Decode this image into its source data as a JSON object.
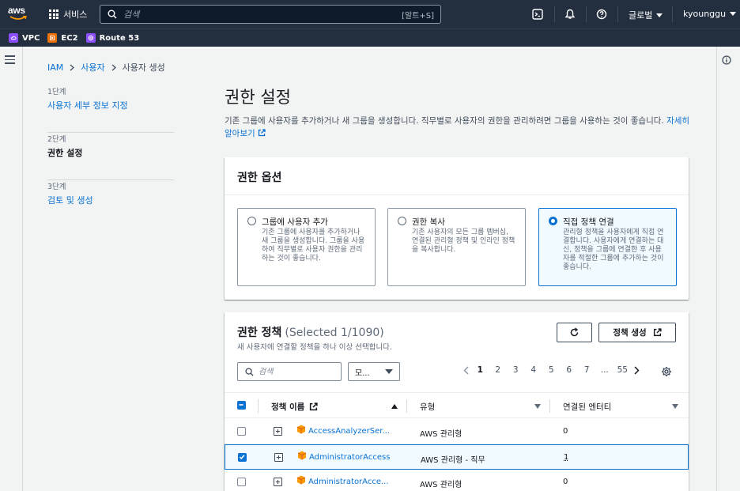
{
  "topnav": {
    "logo": "aws",
    "services_label": "서비스",
    "search_placeholder": "검색",
    "search_shortcut": "[알트+S]",
    "region_label": "글로벌",
    "user_label": "kyounggu"
  },
  "favorites": [
    {
      "label": "VPC",
      "color": "#8c4fff"
    },
    {
      "label": "EC2",
      "color": "#ed7100"
    },
    {
      "label": "Route 53",
      "color": "#8c4fff"
    }
  ],
  "breadcrumb": {
    "items": [
      "IAM",
      "사용자",
      "사용자 생성"
    ]
  },
  "steps": [
    {
      "num": "1단계",
      "title": "사용자 세부 정보 지정"
    },
    {
      "num": "2단계",
      "title": "권한 설정"
    },
    {
      "num": "3단계",
      "title": "검토 및 생성"
    }
  ],
  "page": {
    "title": "권한 설정",
    "desc": "기존 그룹에 사용자를 추가하거나 새 그룹을 생성합니다. 직무별로 사용자의 권한을 관리하려면 그룹을 사용하는 것이 좋습니다.",
    "learn_more": "자세히 알아보기"
  },
  "options": {
    "header": "권한 옵션",
    "tiles": [
      {
        "title": "그룹에 사용자 추가",
        "desc": "기존 그룹에 사용자를 추가하거나 새 그룹을 생성합니다. 그룹을 사용하여 직무별로 사용자 권한을 관리하는 것이 좋습니다."
      },
      {
        "title": "권한 복사",
        "desc": "기존 사용자의 모든 그룹 멤버십, 연결된 관리형 정책 및 인라인 정책을 복사합니다."
      },
      {
        "title": "직접 정책 연결",
        "desc": "관리형 정책을 사용자에게 직접 연결합니다. 사용자에게 연결하는 대신, 정책을 그룹에 연결한 후 사용자를 적절한 그룹에 추가하는 것이 좋습니다."
      }
    ],
    "selected_index": 2
  },
  "policies": {
    "title": "권한 정책",
    "count": "(Selected 1/1090)",
    "subtitle": "새 사용자에 연결할 정책을 하나 이상 선택합니다.",
    "create_label": "정책 생성",
    "filter_placeholder": "검색",
    "select_value": "모...",
    "pages": [
      "1",
      "2",
      "3",
      "4",
      "5",
      "6",
      "7",
      "...",
      "55"
    ],
    "current_page": "1",
    "columns": [
      "정책 이름",
      "유형",
      "연결된 엔터티"
    ],
    "rows": [
      {
        "name": "AccessAnalyzerSer...",
        "type": "AWS 관리형",
        "entities": "0",
        "checked": false
      },
      {
        "name": "AdministratorAccess",
        "type": "AWS 관리형 - 직무",
        "entities": "1",
        "checked": true
      },
      {
        "name": "AdministratorAcce...",
        "type": "AWS 관리형",
        "entities": "0",
        "checked": false
      }
    ]
  }
}
